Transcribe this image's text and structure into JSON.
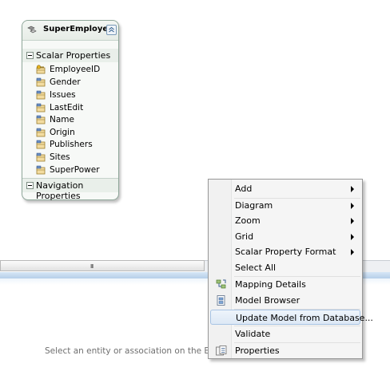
{
  "entity": {
    "title": "SuperEmployee",
    "scalar_section": "Scalar Properties",
    "properties": [
      {
        "label": "EmployeeID",
        "key": true
      },
      {
        "label": "Gender",
        "key": false
      },
      {
        "label": "Issues",
        "key": false
      },
      {
        "label": "LastEdit",
        "key": false
      },
      {
        "label": "Name",
        "key": false
      },
      {
        "label": "Origin",
        "key": false
      },
      {
        "label": "Publishers",
        "key": false
      },
      {
        "label": "Sites",
        "key": false
      },
      {
        "label": "SuperPower",
        "key": false
      }
    ],
    "navigation_section": "Navigation Properties"
  },
  "scrollbar": {
    "grip": "III"
  },
  "status_text": "Select an entity or association on the Entity De",
  "context_menu": {
    "items": [
      {
        "label": "Add",
        "submenu": true,
        "icon": ""
      },
      {
        "label": "Diagram",
        "submenu": true,
        "icon": ""
      },
      {
        "label": "Zoom",
        "submenu": true,
        "icon": ""
      },
      {
        "label": "Grid",
        "submenu": true,
        "icon": ""
      },
      {
        "label": "Scalar Property Format",
        "submenu": true,
        "icon": ""
      },
      {
        "label": "Select All",
        "submenu": false,
        "icon": ""
      },
      {
        "label": "Mapping Details",
        "submenu": false,
        "icon": "mapping-details-icon"
      },
      {
        "label": "Model Browser",
        "submenu": false,
        "icon": "model-browser-icon"
      },
      {
        "label": "Update Model from Database...",
        "submenu": false,
        "icon": "",
        "highlighted": true
      },
      {
        "label": "Validate",
        "submenu": false,
        "icon": ""
      },
      {
        "label": "Properties",
        "submenu": false,
        "icon": "properties-icon"
      }
    ]
  },
  "colors": {
    "menu_highlight": "#dde8f5",
    "panel_accent": "#b6cfe9",
    "entity_border": "#8fa79a"
  }
}
